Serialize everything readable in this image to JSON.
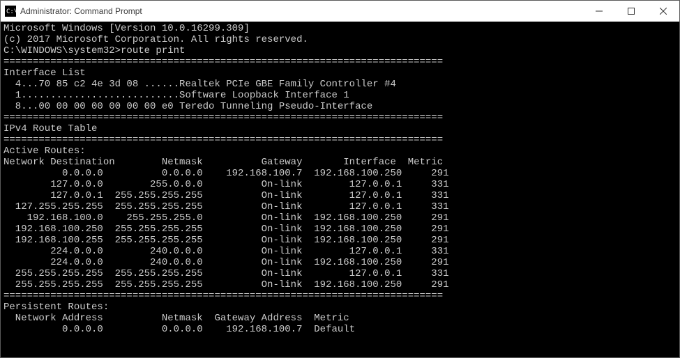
{
  "window": {
    "title": "Administrator: Command Prompt"
  },
  "terminal": {
    "version_line": "Microsoft Windows [Version 10.0.16299.309]",
    "copyright_line": "(c) 2017 Microsoft Corporation. All rights reserved.",
    "prompt": "C:\\WINDOWS\\system32>",
    "command": "route print",
    "sep": "===========================================================================",
    "interface_list_header": "Interface List",
    "interfaces": [
      "  4...70 85 c2 4e 3d 08 ......Realtek PCIe GBE Family Controller #4",
      "  1...........................Software Loopback Interface 1",
      "  8...00 00 00 00 00 00 00 e0 Teredo Tunneling Pseudo-Interface"
    ],
    "ipv4_header": "IPv4 Route Table",
    "active_routes_header": "Active Routes:",
    "active_routes_cols": "Network Destination        Netmask          Gateway       Interface  Metric",
    "active_routes": [
      {
        "dest": "0.0.0.0",
        "mask": "0.0.0.0",
        "gw": "192.168.100.7",
        "iface": "192.168.100.250",
        "metric": "291"
      },
      {
        "dest": "127.0.0.0",
        "mask": "255.0.0.0",
        "gw": "On-link",
        "iface": "127.0.0.1",
        "metric": "331"
      },
      {
        "dest": "127.0.0.1",
        "mask": "255.255.255.255",
        "gw": "On-link",
        "iface": "127.0.0.1",
        "metric": "331"
      },
      {
        "dest": "127.255.255.255",
        "mask": "255.255.255.255",
        "gw": "On-link",
        "iface": "127.0.0.1",
        "metric": "331"
      },
      {
        "dest": "192.168.100.0",
        "mask": "255.255.255.0",
        "gw": "On-link",
        "iface": "192.168.100.250",
        "metric": "291"
      },
      {
        "dest": "192.168.100.250",
        "mask": "255.255.255.255",
        "gw": "On-link",
        "iface": "192.168.100.250",
        "metric": "291"
      },
      {
        "dest": "192.168.100.255",
        "mask": "255.255.255.255",
        "gw": "On-link",
        "iface": "192.168.100.250",
        "metric": "291"
      },
      {
        "dest": "224.0.0.0",
        "mask": "240.0.0.0",
        "gw": "On-link",
        "iface": "127.0.0.1",
        "metric": "331"
      },
      {
        "dest": "224.0.0.0",
        "mask": "240.0.0.0",
        "gw": "On-link",
        "iface": "192.168.100.250",
        "metric": "291"
      },
      {
        "dest": "255.255.255.255",
        "mask": "255.255.255.255",
        "gw": "On-link",
        "iface": "127.0.0.1",
        "metric": "331"
      },
      {
        "dest": "255.255.255.255",
        "mask": "255.255.255.255",
        "gw": "On-link",
        "iface": "192.168.100.250",
        "metric": "291"
      }
    ],
    "persistent_header": "Persistent Routes:",
    "persistent_cols": "  Network Address          Netmask  Gateway Address  Metric",
    "persistent_routes": [
      {
        "addr": "0.0.0.0",
        "mask": "0.0.0.0",
        "gw": "192.168.100.7",
        "metric": "Default"
      }
    ]
  }
}
